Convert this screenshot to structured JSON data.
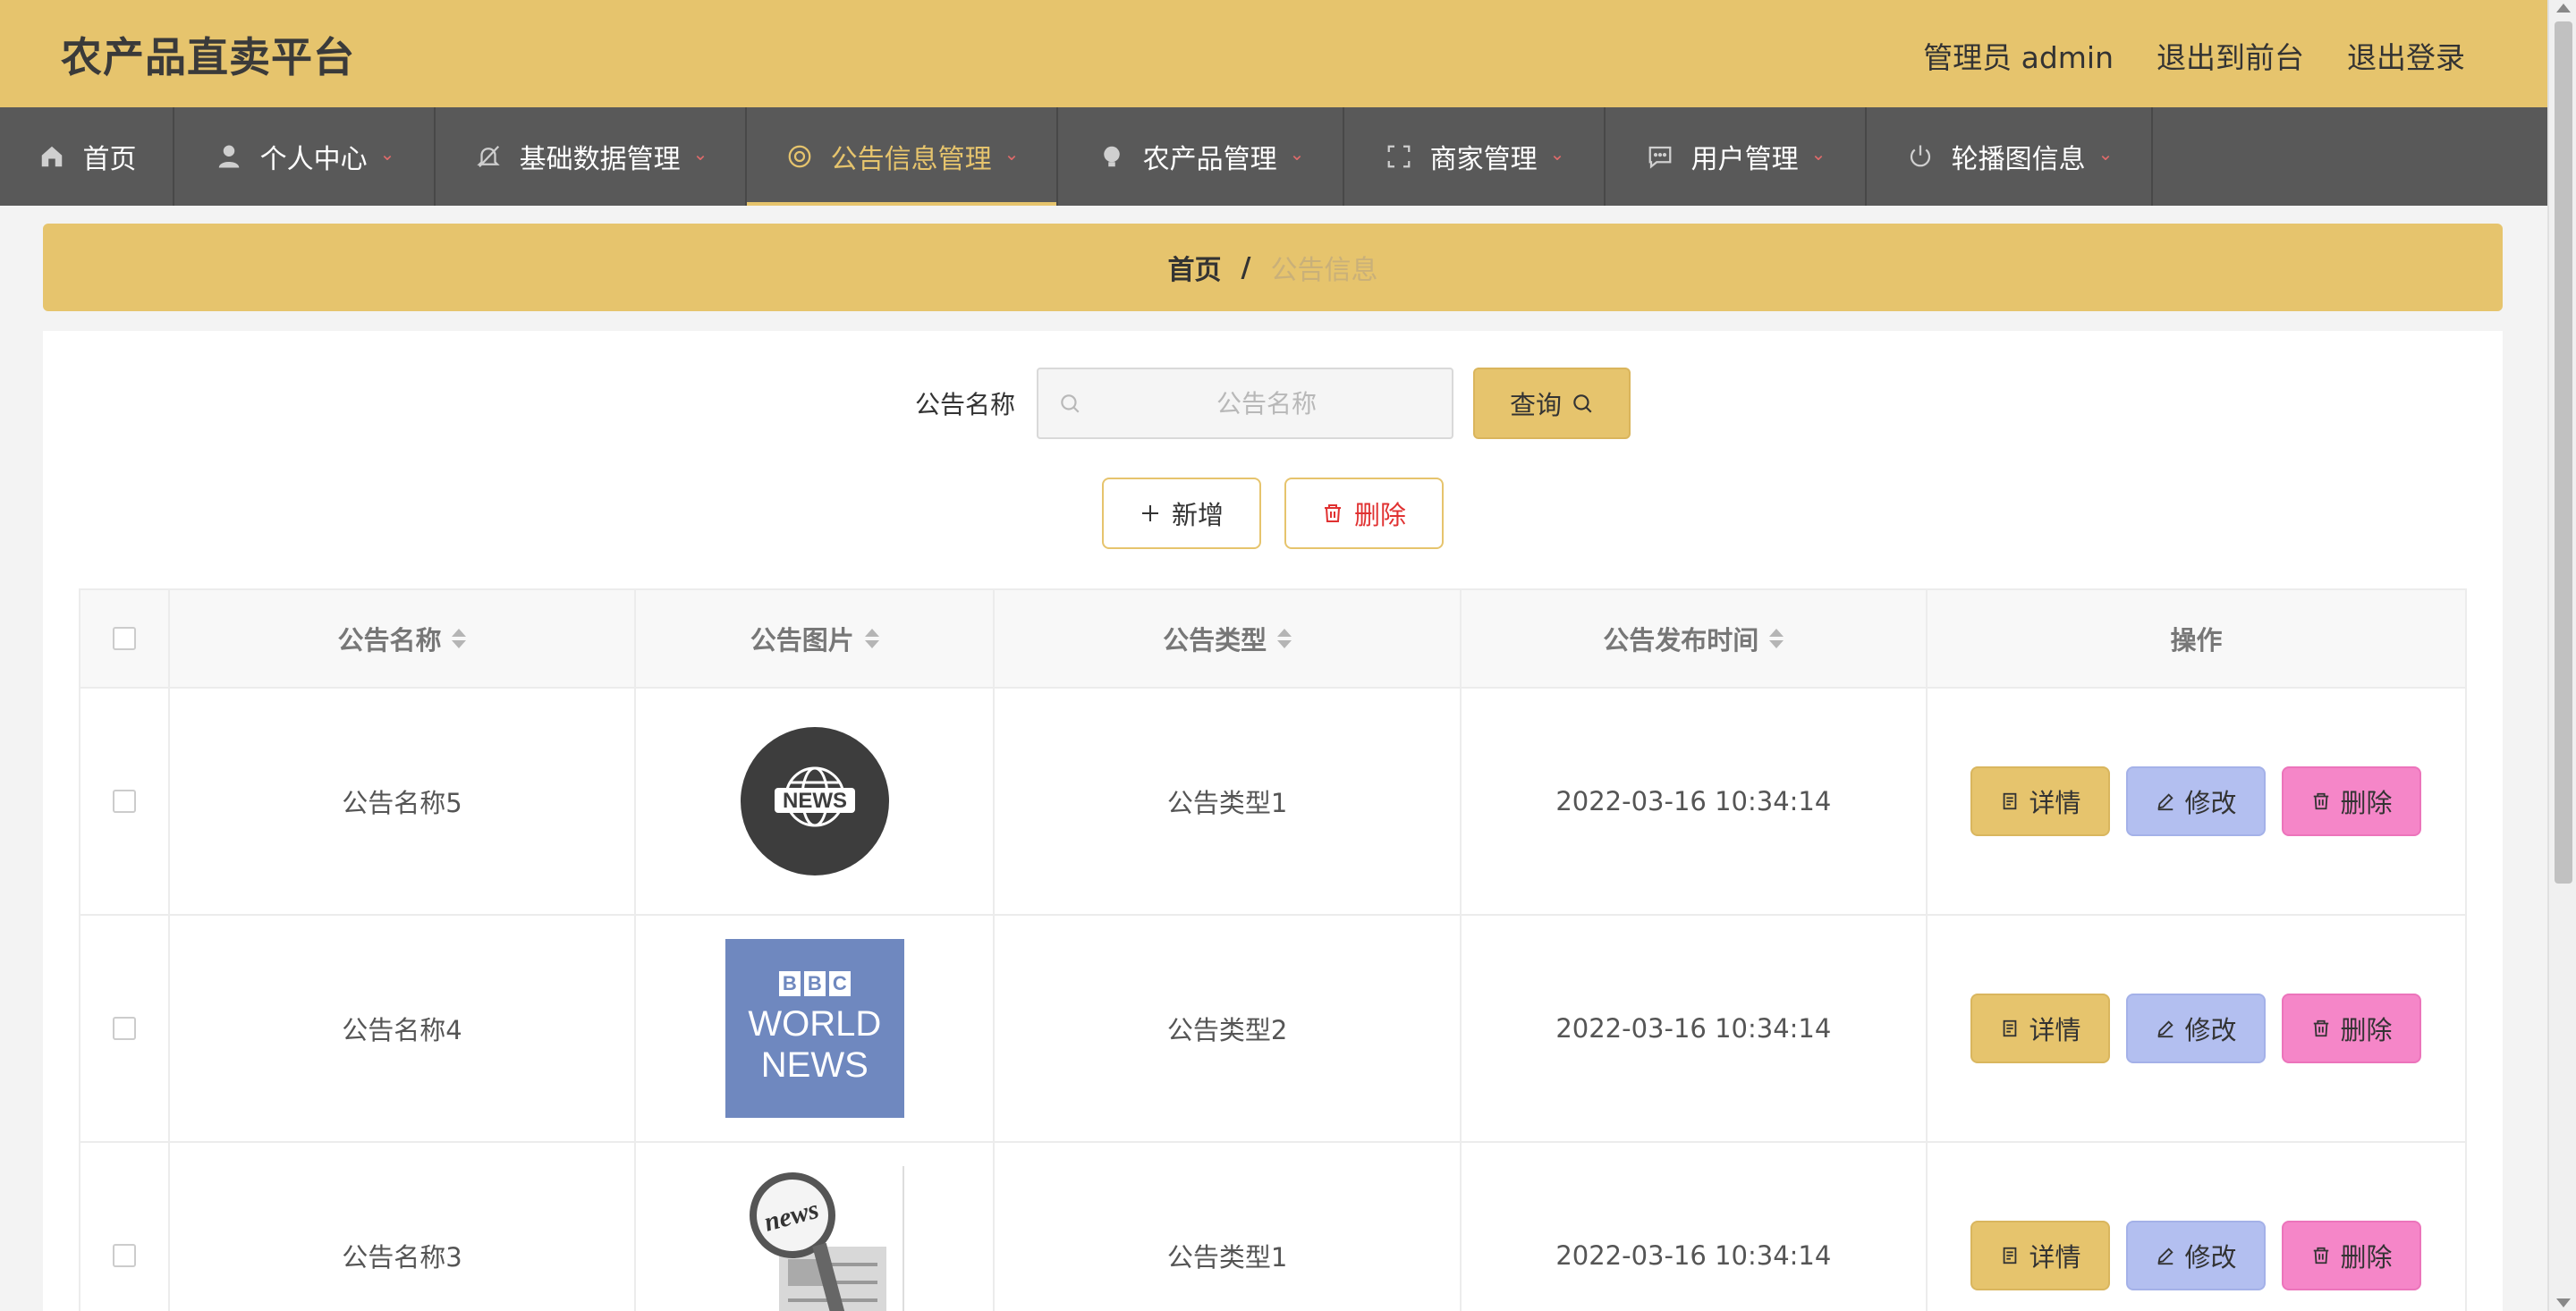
{
  "header": {
    "title": "农产品直卖平台",
    "admin_label": "管理员 admin",
    "to_front": "退出到前台",
    "logout": "退出登录",
    "bg_color": "#e6c46d"
  },
  "nav": {
    "items": [
      {
        "label": "首页",
        "icon": "home-icon"
      },
      {
        "label": "个人中心",
        "icon": "user-icon"
      },
      {
        "label": "基础数据管理",
        "icon": "bell-off-icon"
      },
      {
        "label": "公告信息管理",
        "icon": "lifebuoy-icon",
        "active": true
      },
      {
        "label": "农产品管理",
        "icon": "bulb-icon"
      },
      {
        "label": "商家管理",
        "icon": "fullscreen-icon"
      },
      {
        "label": "用户管理",
        "icon": "chat-icon"
      },
      {
        "label": "轮播图信息",
        "icon": "power-icon"
      }
    ],
    "bg_color": "#595959",
    "active_color": "#e6c46d"
  },
  "breadcrumb": {
    "home": "首页",
    "separator": "/",
    "current": "公告信息"
  },
  "search": {
    "label": "公告名称",
    "placeholder": "公告名称",
    "value": "",
    "button": "查询"
  },
  "actions": {
    "add": "新增",
    "delete": "删除"
  },
  "table": {
    "columns": [
      "公告名称",
      "公告图片",
      "公告类型",
      "公告发布时间",
      "操作"
    ],
    "rows": [
      {
        "name": "公告名称5",
        "image": "news-globe-image",
        "type": "公告类型1",
        "time": "2022-03-16 10:34:14"
      },
      {
        "name": "公告名称4",
        "image": "bbc-world-news-image",
        "type": "公告类型2",
        "time": "2022-03-16 10:34:14"
      },
      {
        "name": "公告名称3",
        "image": "magnifier-news-image",
        "type": "公告类型1",
        "time": "2022-03-16 10:34:14"
      }
    ],
    "ops": {
      "detail": "详情",
      "edit": "修改",
      "delete": "删除"
    }
  },
  "image_text": {
    "news_globe": "NEWS",
    "bbc_letters": [
      "B",
      "B",
      "C"
    ],
    "bbc_line1": "WORLD",
    "bbc_line2": "NEWS",
    "magnifier": "news"
  }
}
